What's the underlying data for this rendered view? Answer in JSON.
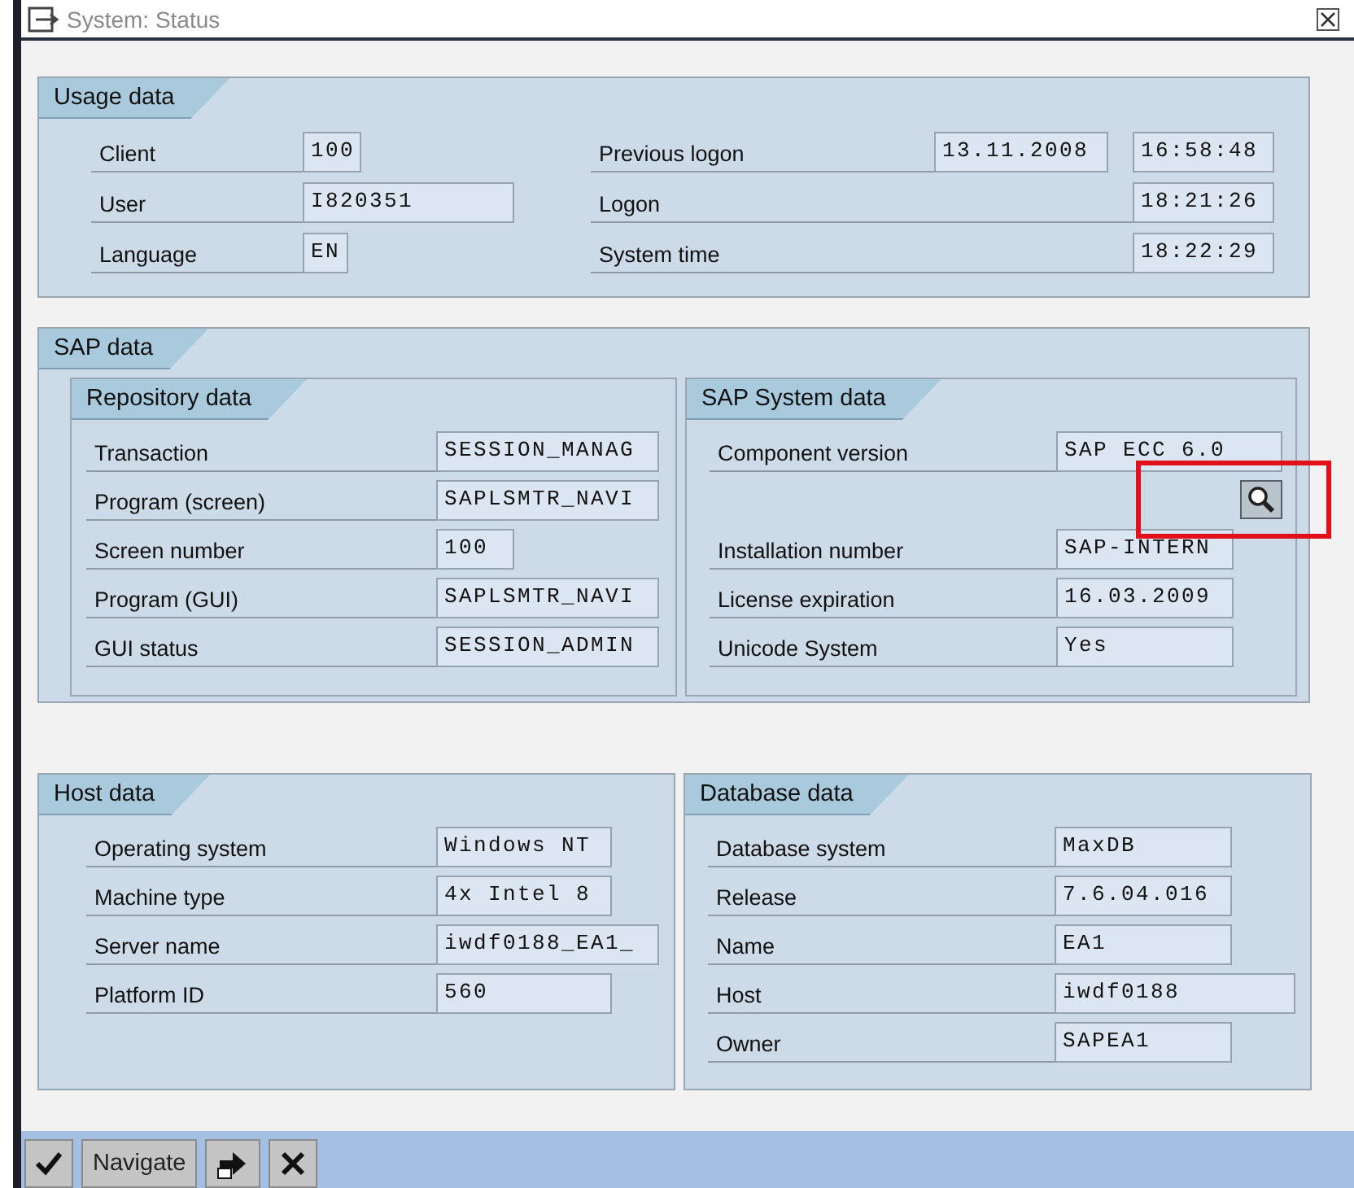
{
  "window": {
    "title": "System: Status"
  },
  "usage_data": {
    "title": "Usage data",
    "left_rows": [
      {
        "label": "Client",
        "values": [
          "100"
        ]
      },
      {
        "label": "User",
        "values": [
          "I820351"
        ]
      },
      {
        "label": "Language",
        "values": [
          "EN"
        ]
      }
    ],
    "right_rows": [
      {
        "label": "Previous logon",
        "values": [
          "13.11.2008",
          "16:58:48"
        ]
      },
      {
        "label": "Logon",
        "values": [
          "18:21:26"
        ]
      },
      {
        "label": "System time",
        "values": [
          "18:22:29"
        ]
      }
    ]
  },
  "sap_data": {
    "title": "SAP data",
    "repository_data": {
      "title": "Repository data",
      "rows": [
        {
          "kind": "field",
          "label": "Transaction",
          "value": "SESSION_MANAG"
        },
        {
          "kind": "field",
          "label": "Program (screen)",
          "value": "SAPLSMTR_NAVI"
        },
        {
          "kind": "field",
          "label": "Screen number",
          "value": "100"
        },
        {
          "kind": "field",
          "label": "Program (GUI)",
          "value": "SAPLSMTR_NAVI"
        },
        {
          "kind": "field",
          "label": "GUI status",
          "value": "SESSION_ADMIN"
        }
      ]
    },
    "sap_system_data": {
      "title": "SAP System data",
      "rows": [
        {
          "kind": "field",
          "label": "Component version",
          "value": "SAP ECC 6.0"
        },
        {
          "kind": "button",
          "highlighted": true
        },
        {
          "kind": "field",
          "label": "Installation number",
          "value": "SAP-INTERN"
        },
        {
          "kind": "field",
          "label": "License expiration",
          "value": "16.03.2009"
        },
        {
          "kind": "field",
          "label": "Unicode System",
          "value": "Yes"
        }
      ]
    }
  },
  "host_data": {
    "title": "Host data",
    "rows": [
      {
        "kind": "field",
        "label": "Operating system",
        "value": "Windows NT"
      },
      {
        "kind": "field",
        "label": "Machine type",
        "value": "4x Intel 8"
      },
      {
        "kind": "field",
        "label": "Server name",
        "value": "iwdf0188_EA1_"
      },
      {
        "kind": "field",
        "label": "Platform ID",
        "value": "560"
      }
    ]
  },
  "database_data": {
    "title": "Database data",
    "rows": [
      {
        "kind": "field",
        "label": "Database system",
        "value": "MaxDB"
      },
      {
        "kind": "field",
        "label": "Release",
        "value": "7.6.04.016"
      },
      {
        "kind": "field",
        "label": "Name",
        "value": "EA1"
      },
      {
        "kind": "field",
        "label": "Host",
        "value": "iwdf0188"
      },
      {
        "kind": "field",
        "label": "Owner",
        "value": "SAPEA1"
      }
    ]
  },
  "toolbar": {
    "buttons": [
      {
        "kind": "check"
      },
      {
        "kind": "text",
        "label": "Navigate"
      },
      {
        "kind": "arrow"
      },
      {
        "kind": "cancel"
      }
    ]
  }
}
